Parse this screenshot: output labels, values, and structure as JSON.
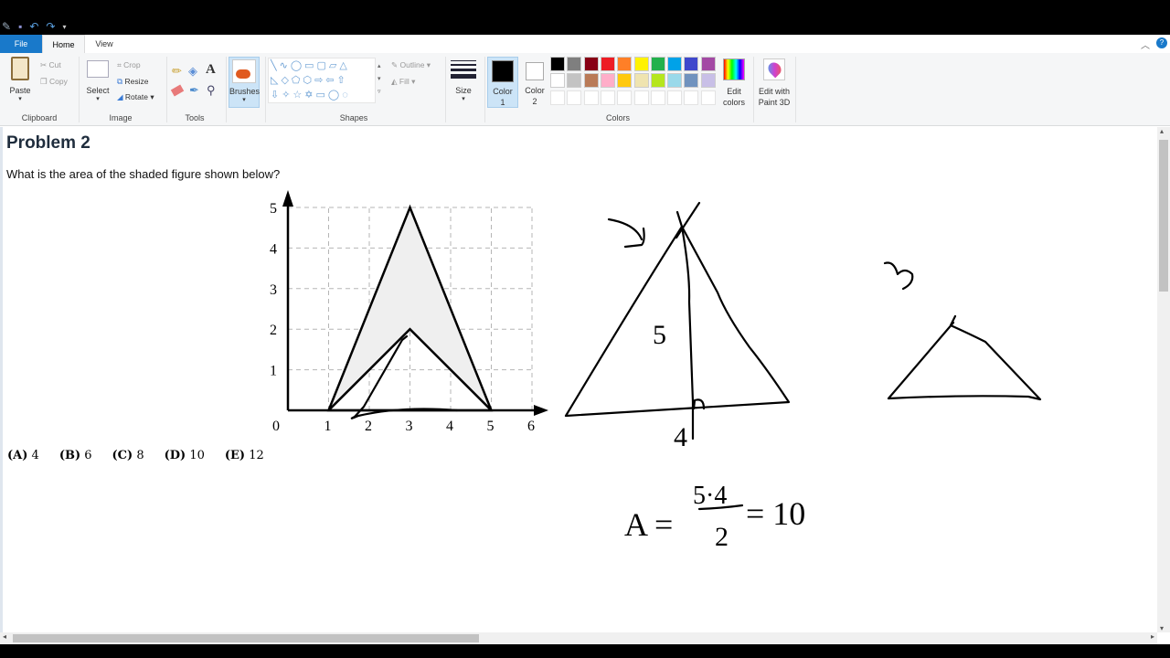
{
  "quick_access": {
    "icons": [
      "paint-app-icon",
      "save-icon",
      "undo-icon",
      "redo-icon",
      "customize-icon"
    ]
  },
  "tabs": [
    {
      "label": "File"
    },
    {
      "label": "Home"
    },
    {
      "label": "View"
    }
  ],
  "ribbon": {
    "clipboard": {
      "label": "Clipboard",
      "paste": "Paste",
      "cut": "Cut",
      "copy": "Copy"
    },
    "image": {
      "label": "Image",
      "select": "Select",
      "crop": "Crop",
      "resize": "Resize",
      "rotate": "Rotate"
    },
    "tools": {
      "label": "Tools"
    },
    "brushes": {
      "label": "Brushes"
    },
    "shapes": {
      "label": "Shapes",
      "outline": "Outline",
      "fill": "Fill"
    },
    "size": {
      "label": "Size"
    },
    "colors": {
      "label": "Colors",
      "color1": "Color 1",
      "color2": "Color 2",
      "edit_colors": "Edit colors",
      "paint3d": "Edit with Paint 3D",
      "color1_value": "#000000",
      "color2_value": "#ffffff",
      "palette_row1": [
        "#000000",
        "#7f7f7f",
        "#880015",
        "#ed1c24",
        "#ff7f27",
        "#fff200",
        "#22b14c",
        "#00a2e8",
        "#3f48cc",
        "#a349a4"
      ],
      "palette_row2": [
        "#ffffff",
        "#c3c3c3",
        "#b97a57",
        "#ffaec9",
        "#ffc90e",
        "#efe4b0",
        "#b5e61d",
        "#99d9ea",
        "#7092be",
        "#c8bfe7"
      ]
    }
  },
  "document": {
    "title": "Problem 2",
    "question": "What is the area of the shaded figure shown below?",
    "choices": [
      {
        "letter": "(A)",
        "value": "4"
      },
      {
        "letter": "(B)",
        "value": "6"
      },
      {
        "letter": "(C)",
        "value": "8"
      },
      {
        "letter": "(D)",
        "value": "10"
      },
      {
        "letter": "(E)",
        "value": "12"
      }
    ],
    "figure": {
      "x_ticks": [
        "0",
        "1",
        "2",
        "3",
        "4",
        "5",
        "6"
      ],
      "y_ticks": [
        "1",
        "2",
        "3",
        "4",
        "5"
      ],
      "outer_triangle": [
        [
          1,
          0
        ],
        [
          3,
          5
        ],
        [
          5,
          0
        ]
      ],
      "inner_triangle": [
        [
          1,
          0
        ],
        [
          3,
          2
        ],
        [
          5,
          0
        ]
      ],
      "shade_color": "#efefef"
    },
    "handwriting": {
      "height_label": "5",
      "base_label": "4",
      "eq_lhs": "A =",
      "eq_num": "5·4",
      "eq_den": "2",
      "eq_rhs": "= 10"
    }
  }
}
